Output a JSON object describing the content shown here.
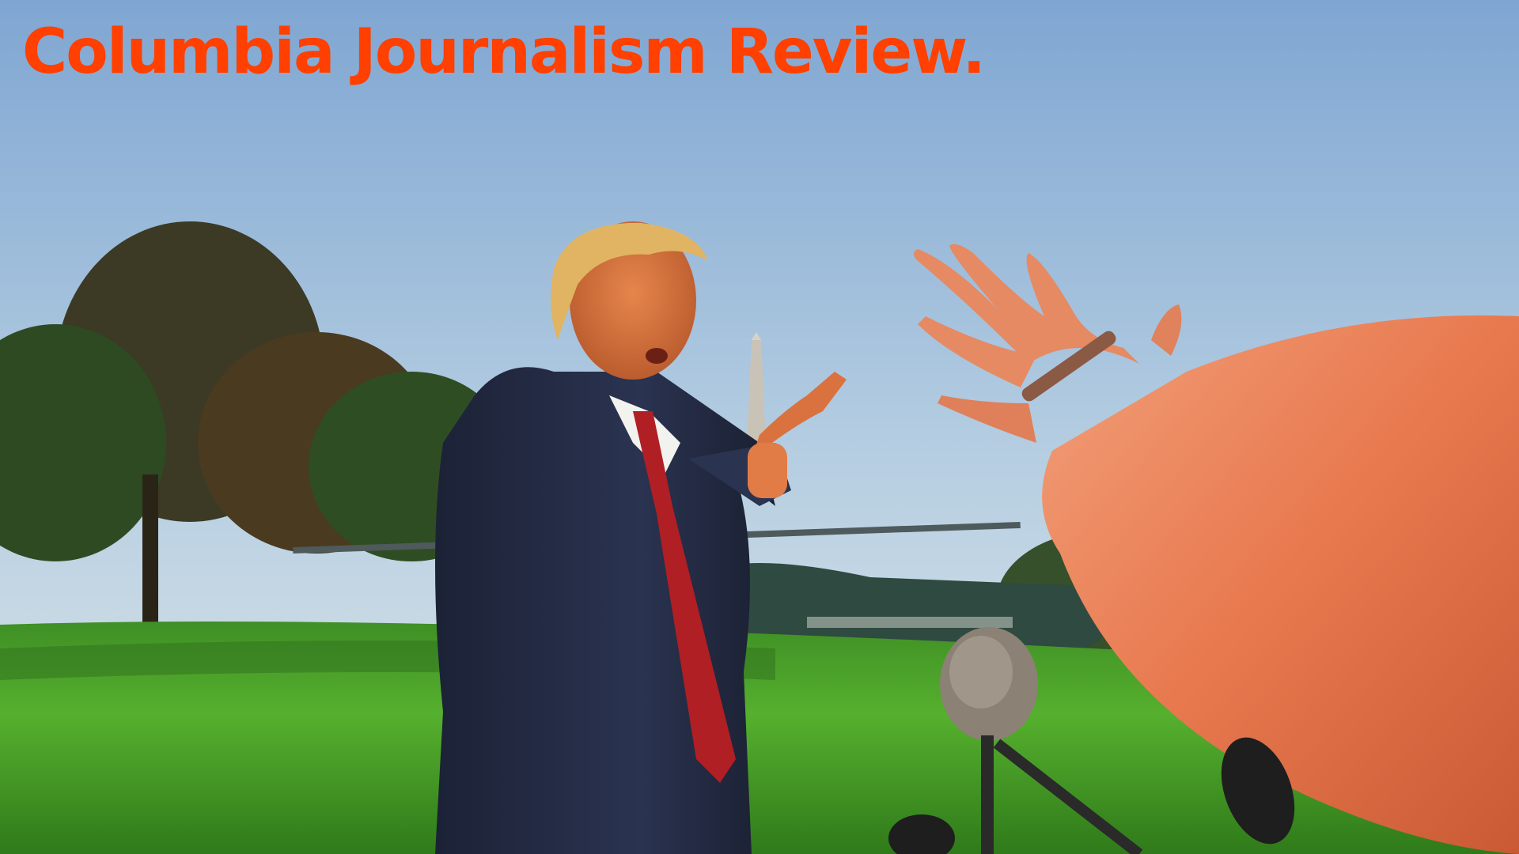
{
  "masthead": {
    "title": "Columbia Journalism Review.",
    "color": "#ff4000"
  },
  "photo": {
    "subject_icons": [
      "tree-icon",
      "monument-icon",
      "helicopter-icon",
      "person-icon",
      "hand-icon",
      "microphone-icon"
    ]
  }
}
